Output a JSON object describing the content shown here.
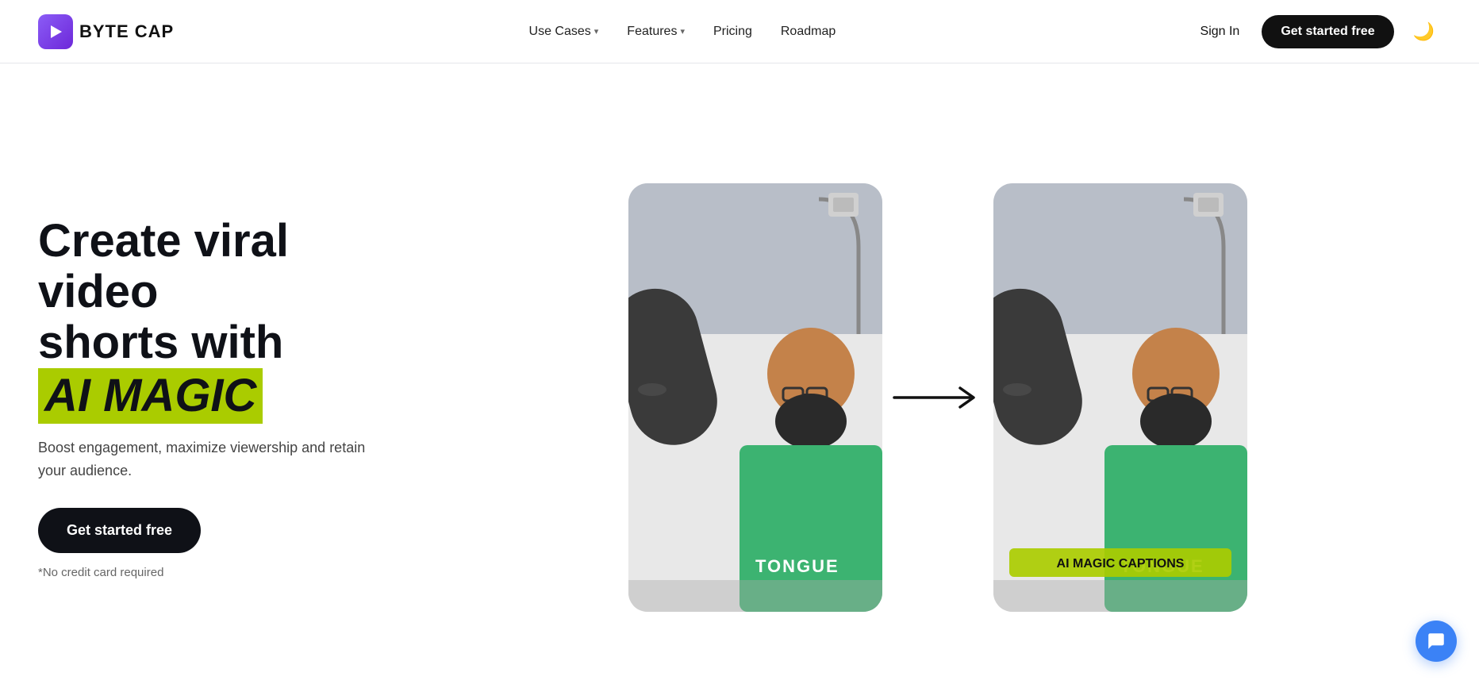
{
  "brand": {
    "name": "BYTE CAP",
    "logo_alt": "ByteCap logo"
  },
  "nav": {
    "items": [
      {
        "label": "Use Cases",
        "has_dropdown": true
      },
      {
        "label": "Features",
        "has_dropdown": true
      },
      {
        "label": "Pricing",
        "has_dropdown": false
      },
      {
        "label": "Roadmap",
        "has_dropdown": false
      }
    ],
    "signin_label": "Sign In",
    "cta_label": "Get started free",
    "dark_mode_icon": "🌙"
  },
  "hero": {
    "title_line1": "Create viral video",
    "title_line2": "shorts with",
    "title_highlight": "AI MAGIC",
    "subtitle": "Boost engagement, maximize viewership and retain your audience.",
    "cta_label": "Get started free",
    "note": "*No credit card required"
  },
  "arrow": {
    "label": "arrow-right"
  },
  "chat": {
    "label": "Chat support"
  }
}
